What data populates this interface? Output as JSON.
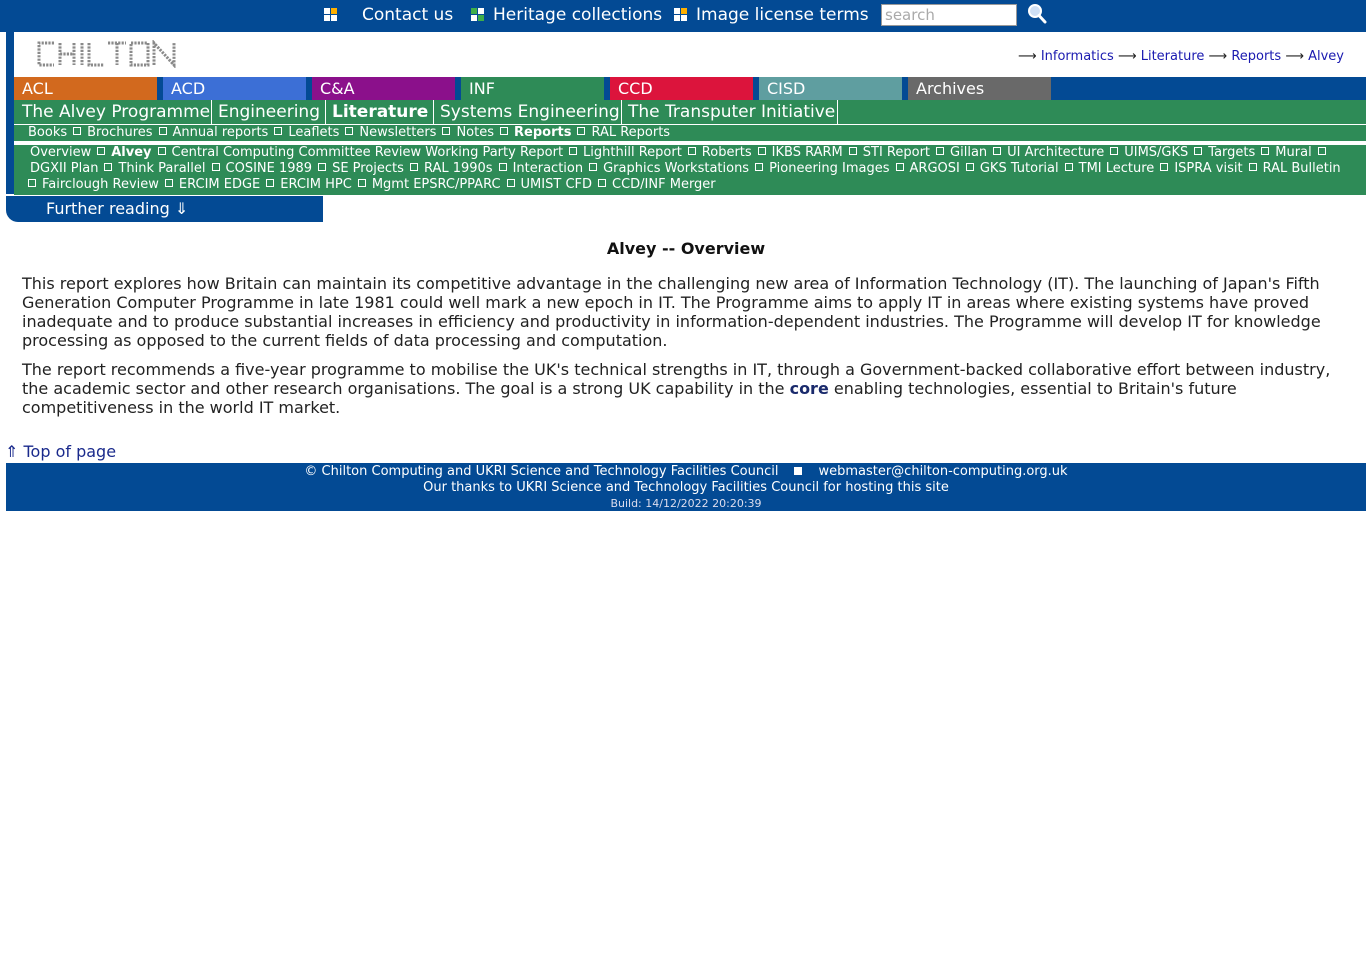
{
  "topbar": {
    "contact": "Contact us",
    "heritage": "Heritage collections",
    "license": "Image license terms",
    "search_placeholder": "search"
  },
  "logo_text": "CHILTON",
  "breadcrumb": {
    "arrow": "⟶",
    "items": [
      "Informatics",
      "Literature",
      "Reports",
      "Alvey"
    ]
  },
  "tabs": [
    {
      "label": "ACL",
      "color": "#d2691e"
    },
    {
      "label": "ACD",
      "color": "#3c6fd6"
    },
    {
      "label": "C&A",
      "color": "#8b108b"
    },
    {
      "label": "INF",
      "color": "#2e8b57"
    },
    {
      "label": "CCD",
      "color": "#dc143c"
    },
    {
      "label": "CISD",
      "color": "#5f9ea0"
    },
    {
      "label": "Archives",
      "color": "#696969"
    }
  ],
  "subnav": [
    "The Alvey Programme",
    "Engineering",
    "Literature",
    "Systems Engineering",
    "The Transputer Initiative"
  ],
  "lit_nav": [
    "Books",
    "Brochures",
    "Annual reports",
    "Leaflets",
    "Newsletters",
    "Notes",
    "Reports",
    "RAL Reports"
  ],
  "rep_nav": {
    "line1": [
      "Overview",
      "Alvey",
      "Central Computing Committee Review Working Party Report",
      "Lighthill Report",
      "Roberts",
      "IKBS RARM",
      "STI Report",
      "Gillan",
      "UI Architecture",
      "UIMS/GKS",
      "Targets",
      "Mural"
    ],
    "line2": [
      "DGXII Plan",
      "Think Parallel",
      "COSINE 1989",
      "SE Projects",
      "RAL 1990s",
      "Interaction",
      "Graphics Workstations",
      "Pioneering Images",
      "ARGOSI",
      "GKS Tutorial",
      "TMI Lecture",
      "ISPRA visit",
      "RAL Bulletin"
    ],
    "line3": [
      "Fairclough Review",
      "ERCIM EDGE",
      "ERCIM HPC",
      "Mgmt EPSRC/PPARC",
      "UMIST CFD",
      "CCD/INF Merger"
    ]
  },
  "further_reading": "Further reading ⇓",
  "content": {
    "title": "Alvey -- Overview",
    "p1": "This report explores how Britain can maintain its competitive advantage in the challenging new area of Information Technology (IT). The launching of Japan's Fifth Generation Computer Programme in late 1981 could well mark a new epoch in IT. The Programme aims to apply IT in areas where existing systems have proved inadequate and to produce substantial increases in efficiency and productivity in information-dependent industries. The Programme will develop IT for knowledge processing as opposed to the current fields of data processing and computation.",
    "p2_before": "The report recommends a five-year programme to mobilise the UK's technical strengths in IT, through a Government-backed collaborative effort between industry, the academic sector and other research organisations. The goal is a strong UK capability in the ",
    "p2_bold": "core",
    "p2_after": " enabling technologies, essential to Britain's future competitiveness in the world IT market."
  },
  "top_of_page": "⇑ Top of page",
  "footer": {
    "copyright": "© Chilton Computing and UKRI Science and Technology Facilities Council",
    "email": "webmaster@chilton-computing.org.uk",
    "thanks": "Our thanks to UKRI Science and Technology Facilities Council for hosting this site",
    "build": "Build: 14/12/2022 20:20:39"
  }
}
